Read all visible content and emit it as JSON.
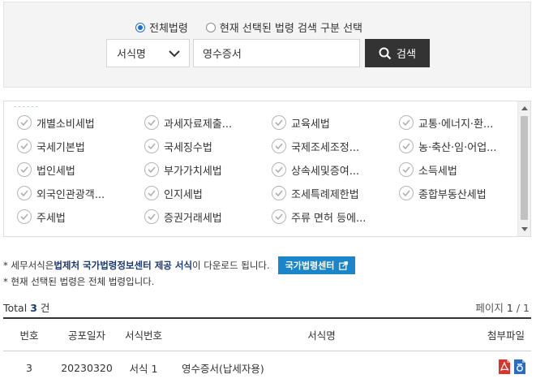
{
  "search": {
    "radio_all_label": "전체법령",
    "radio_selected_label": "현재 선택된 법령 검색 구분 선택",
    "select_value": "서식명",
    "input_value": "영수증서",
    "button_label": "검색"
  },
  "categories": [
    "개별소비세법",
    "과세자료제출...",
    "교육세법",
    "교통·에너지·환...",
    "국세기본법",
    "국세징수법",
    "국제조세조정...",
    "농·축산·임·어업...",
    "법인세법",
    "부가가치세법",
    "상속세및증여...",
    "소득세법",
    "외국인관광객...",
    "인지세법",
    "조세특례제한법",
    "종합부동산세법",
    "주세법",
    "증권거래세법",
    "주류 면허 등에..."
  ],
  "notice": {
    "line1_prefix": "* 세무서식은 ",
    "line1_bold": "법제처 국가법령정보센터 제공 서식",
    "line1_suffix": "이 다운로드 됩니다.",
    "nlaw_button": "국가법령센터",
    "line2": "* 현재 선택된 법령은 전체 법령입니다."
  },
  "summary": {
    "total_label": "Total",
    "total_count": "3",
    "total_unit": "건",
    "page_label": "페이지",
    "page_current": "1",
    "page_sep": "/",
    "page_total": "1"
  },
  "table": {
    "headers": [
      "번호",
      "공포일자",
      "서식번호",
      "서식명",
      "첨부파일"
    ],
    "rows": [
      {
        "no": "3",
        "date": "20230320",
        "form_no": "서식 1",
        "name": "영수증서(납세자용)"
      }
    ]
  },
  "colors": {
    "accent_blue": "#1a86c9",
    "title_blue": "#1b3a75",
    "button_dark": "#333333",
    "pdf_red": "#d9342b",
    "hwp_blue": "#2b6cc4"
  }
}
